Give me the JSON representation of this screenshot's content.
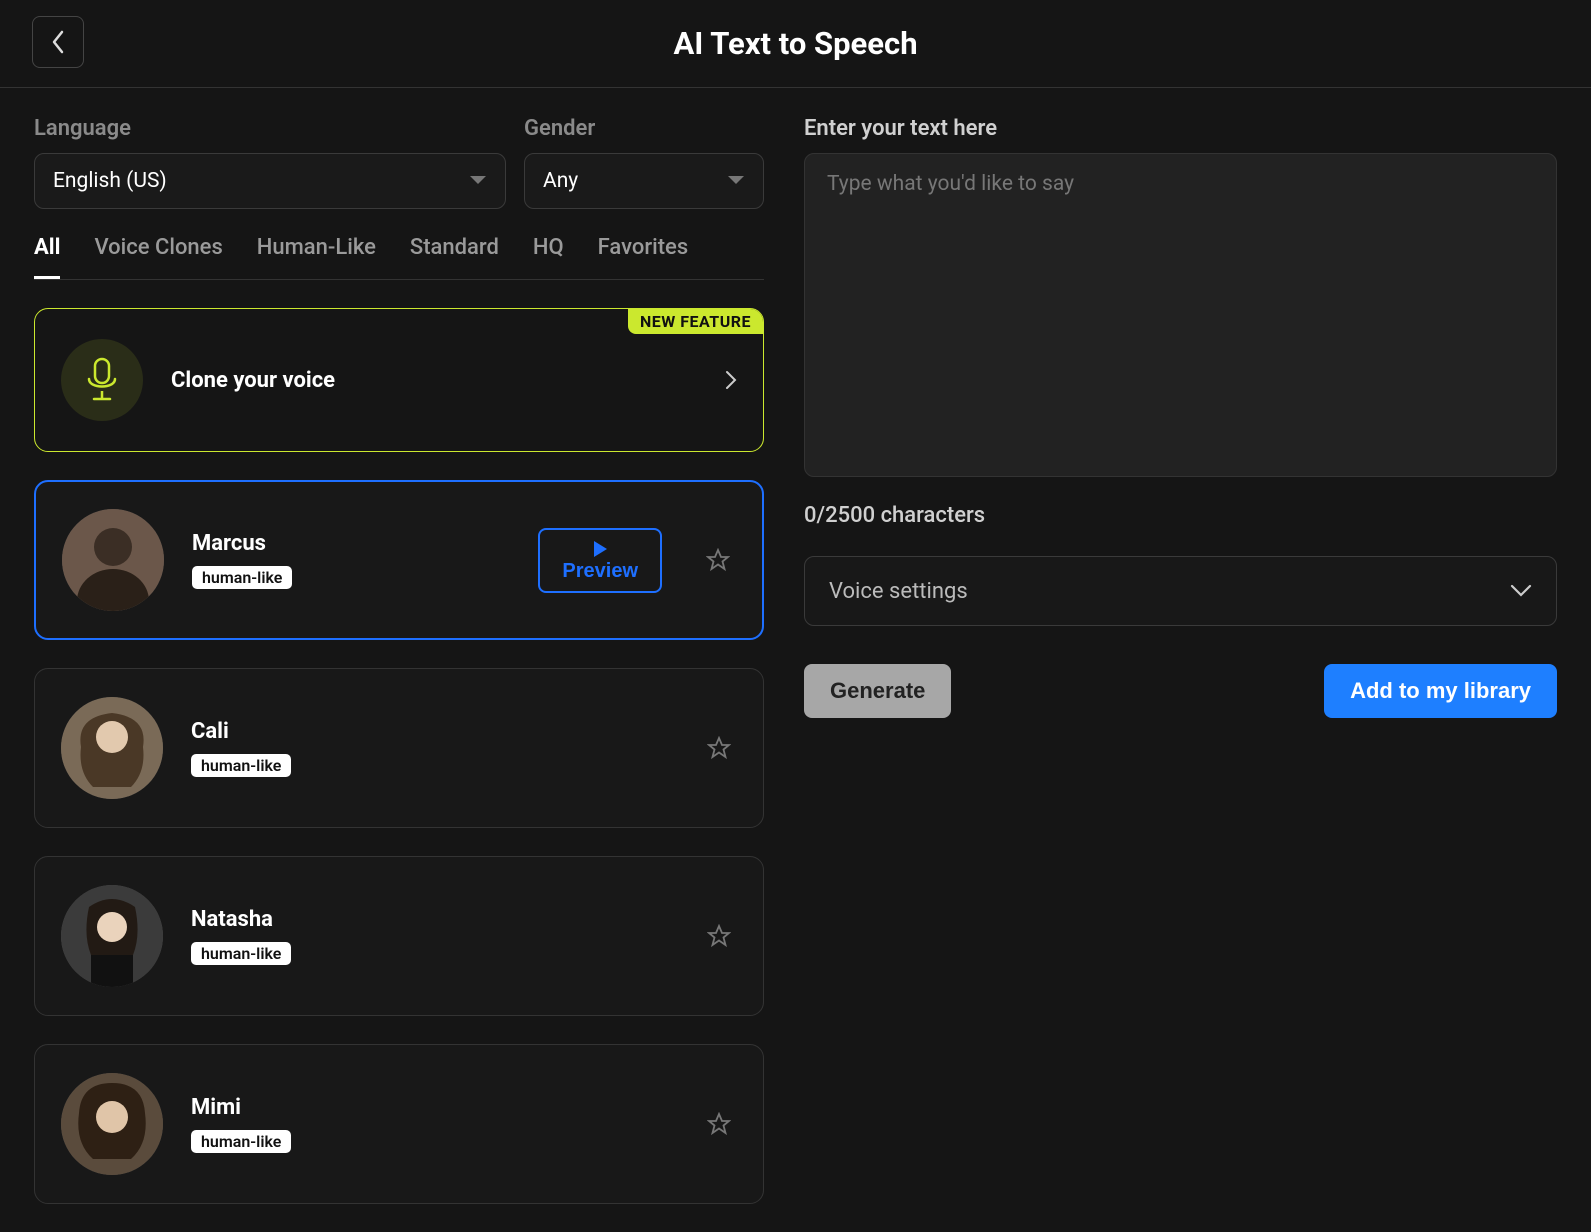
{
  "header": {
    "title": "AI Text to Speech"
  },
  "filters": {
    "language_label": "Language",
    "language_value": "English (US)",
    "gender_label": "Gender",
    "gender_value": "Any"
  },
  "tabs": [
    {
      "label": "All",
      "active": true
    },
    {
      "label": "Voice Clones",
      "active": false
    },
    {
      "label": "Human-Like",
      "active": false
    },
    {
      "label": "Standard",
      "active": false
    },
    {
      "label": "HQ",
      "active": false
    },
    {
      "label": "Favorites",
      "active": false
    }
  ],
  "clone_card": {
    "badge": "NEW FEATURE",
    "title": "Clone your voice"
  },
  "voices": [
    {
      "name": "Marcus",
      "tag": "human-like",
      "selected": true,
      "preview_label": "Preview"
    },
    {
      "name": "Cali",
      "tag": "human-like",
      "selected": false
    },
    {
      "name": "Natasha",
      "tag": "human-like",
      "selected": false
    },
    {
      "name": "Mimi",
      "tag": "human-like",
      "selected": false
    }
  ],
  "right": {
    "text_label": "Enter your text here",
    "placeholder": "Type what you'd like to say",
    "char_count": "0/2500 characters",
    "voice_settings_label": "Voice settings",
    "generate_label": "Generate",
    "library_label": "Add to my library"
  },
  "avatar_colors": [
    "#6b574a",
    "#7a6a57",
    "#3b3b3b",
    "#5a4b3c"
  ]
}
